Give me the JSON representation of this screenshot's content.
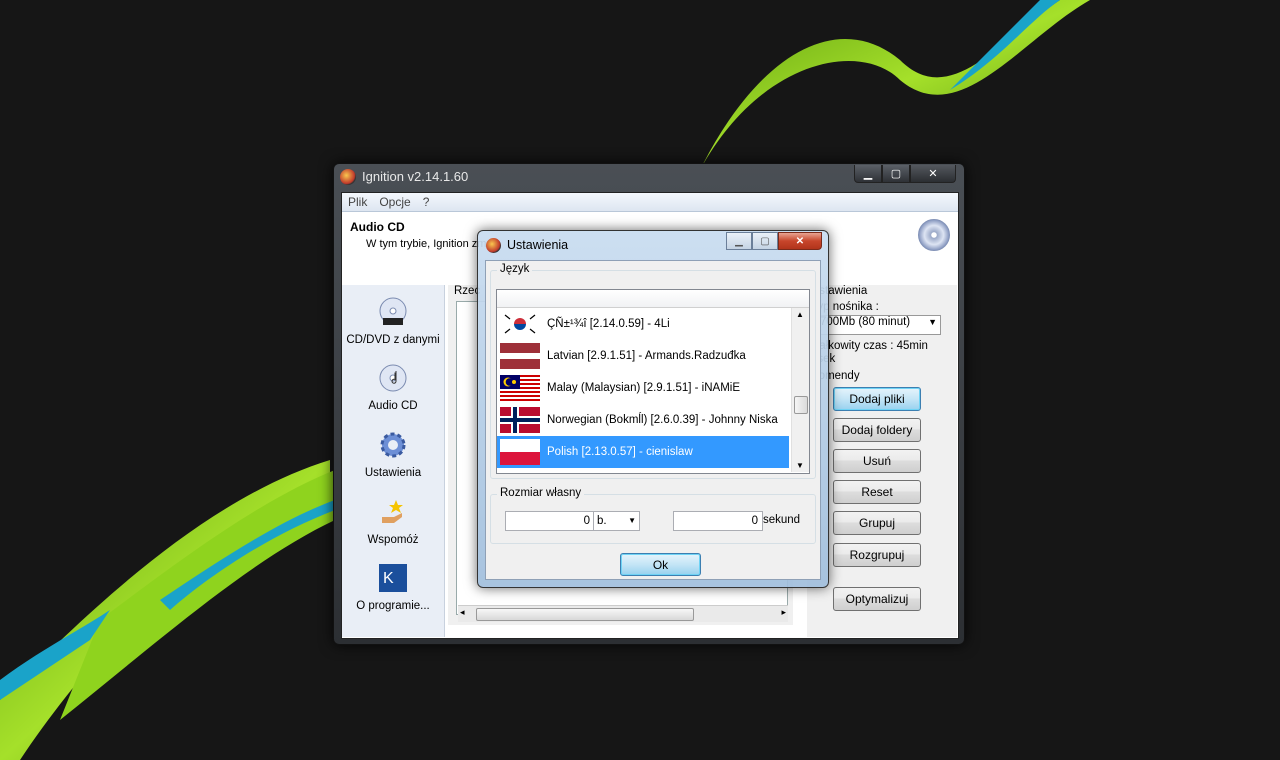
{
  "main_window": {
    "title": "Ignition v2.14.1.60",
    "menu": [
      "Plik",
      "Opcje",
      "?"
    ],
    "header_title": "Audio CD",
    "header_desc": "W tym trybie, Ignition zm",
    "sidebar": [
      {
        "label": "CD/DVD z danymi",
        "icon": "dvd-cd-icon"
      },
      {
        "label": "Audio CD",
        "icon": "audio-cd-icon"
      },
      {
        "label": "Ustawienia",
        "icon": "gear-icon"
      },
      {
        "label": "Wspomóż",
        "icon": "donate-hand-icon"
      },
      {
        "label": "O programie...",
        "icon": "about-logo-icon"
      }
    ],
    "content_label": "Rzec",
    "right_panel": {
      "group_settings": "Ustawienia",
      "media_type_label": "Typ nośnika :",
      "media_type_value": "700Mb (80 minut)",
      "total_time": "Całkowity czas : 45min",
      "total_time_line2": "0sek",
      "commands_label": "Komendy",
      "buttons": [
        "Dodaj pliki",
        "Dodaj foldery",
        "Usuń",
        "Reset",
        "Grupuj",
        "Rozgrupuj",
        "Optymalizuj"
      ]
    }
  },
  "dialog": {
    "title": "Ustawienia",
    "language_group": "Język",
    "languages": [
      {
        "label": "ÇÑ±¹¾î [2.14.0.59] - 4Li",
        "flag": "south-korea"
      },
      {
        "label": "Latvian [2.9.1.51] - Armands.Radzuđka",
        "flag": "latvia"
      },
      {
        "label": "Malay (Malaysian) [2.9.1.51] - iNAMiE",
        "flag": "malaysia"
      },
      {
        "label": "Norwegian (Bokmĺl) [2.6.0.39] - Johnny Niska",
        "flag": "norway"
      },
      {
        "label": "Polish [2.13.0.57] - cienislaw",
        "flag": "poland",
        "selected": true
      }
    ],
    "custom_size_group": "Rozmiar własny",
    "size_value": "0",
    "size_unit": "b.",
    "seconds_value": "0",
    "seconds_label": "sekund",
    "ok_label": "Ok"
  },
  "colors": {
    "selection": "#3399ff",
    "wallpaper_green": "#8fd31e",
    "wallpaper_teal": "#1aa3c9"
  }
}
